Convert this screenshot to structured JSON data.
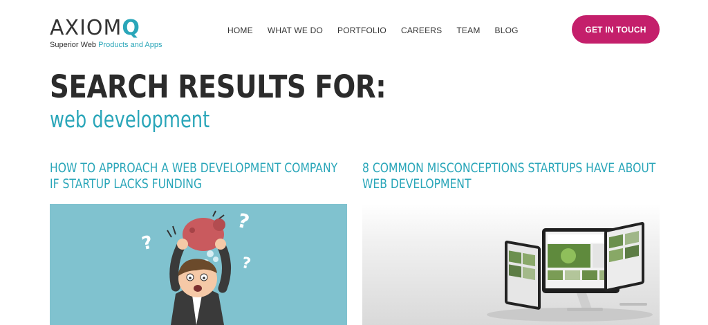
{
  "header": {
    "logo_text": "AXIOM",
    "logo_q": "Q",
    "tagline_plain": "Superior Web",
    "tagline_accent": "Products and Apps",
    "nav": [
      "HOME",
      "WHAT WE DO",
      "PORTFOLIO",
      "CAREERS",
      "TEAM",
      "BLOG"
    ],
    "cta_label": "GET IN TOUCH"
  },
  "search": {
    "heading": "SEARCH RESULTS FOR:",
    "query": "web development"
  },
  "results": [
    {
      "title": "HOW TO APPROACH A WEB DEVELOPMENT COMPANY IF STARTUP LACKS FUNDING",
      "image": "startup-man-with-piggy-bank-illustration"
    },
    {
      "title": "8 COMMON MISCONCEPTIONS STARTUPS HAVE ABOUT WEB DEVELOPMENT",
      "image": "computer-monitors-illustration"
    }
  ],
  "colors": {
    "accent": "#2aa6b9",
    "cta": "#c41f6b",
    "text": "#2b2b2b",
    "thumb_blue": "#80c2cf"
  }
}
